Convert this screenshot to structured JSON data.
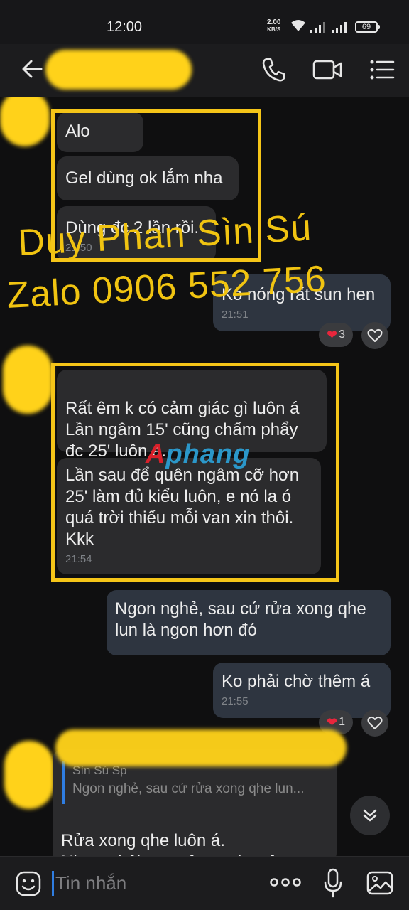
{
  "status_bar": {
    "time": "12:00",
    "net_speed_value": "2.00",
    "net_speed_unit": "KB/S",
    "battery": "69"
  },
  "header": {
    "back_icon": "arrow-left-icon",
    "call_icon": "phone-icon",
    "video_icon": "video-camera-icon",
    "menu_icon": "list-menu-icon"
  },
  "messages": {
    "m1": {
      "text": "Alo"
    },
    "m2": {
      "text": "Gel dùng ok lắm nha"
    },
    "m3": {
      "text": "Dùng đc 2 lần rồi.",
      "time": "21:50"
    },
    "m4": {
      "text": "Ko nóng rất sun hen",
      "time": "21:51",
      "reaction_count": "3"
    },
    "m5": {
      "text": "Rất êm k có cảm giác gì luôn á\nLần ngâm 15' cũng chấm phẩy đc 25' luôn á."
    },
    "m6": {
      "text": "Lần sau để quên ngâm cỡ hơn 25' làm đủ kiểu luôn, e nó la ó quá trời thiếu mỗi van xin thôi. Kkk",
      "time": "21:54"
    },
    "m7": {
      "text": "Ngon nghẻ, sau cứ rửa xong qhe lun là ngon hơn đó"
    },
    "m8": {
      "text": "Ko phải chờ thêm á",
      "time": "21:55",
      "reaction_count": "1"
    },
    "m9": {
      "quote_name": "Sìn Sú Sp",
      "quote_text": "Ngon nghẻ, sau cứ rửa xong qhe lun...",
      "text": "Rửa xong qhe luôn á.\nNhưng bôi xong êm quá quên"
    }
  },
  "watermark": {
    "line1": "Duy Phan Sìn Sú",
    "line2": "Zalo 0906 552 756",
    "logo_part1": "A",
    "logo_part2": "phang"
  },
  "input_bar": {
    "placeholder": "Tin nhắn",
    "emoji_icon": "emoji-icon",
    "more_icon": "more-dots-icon",
    "mic_icon": "microphone-icon",
    "image_icon": "image-icon"
  },
  "colors": {
    "highlight_box": "#f5c518",
    "watermark": "#f1c411",
    "incoming_bubble": "#2b2b2d",
    "outgoing_bubble": "#2e3540",
    "reaction_heart": "#e8263c"
  }
}
